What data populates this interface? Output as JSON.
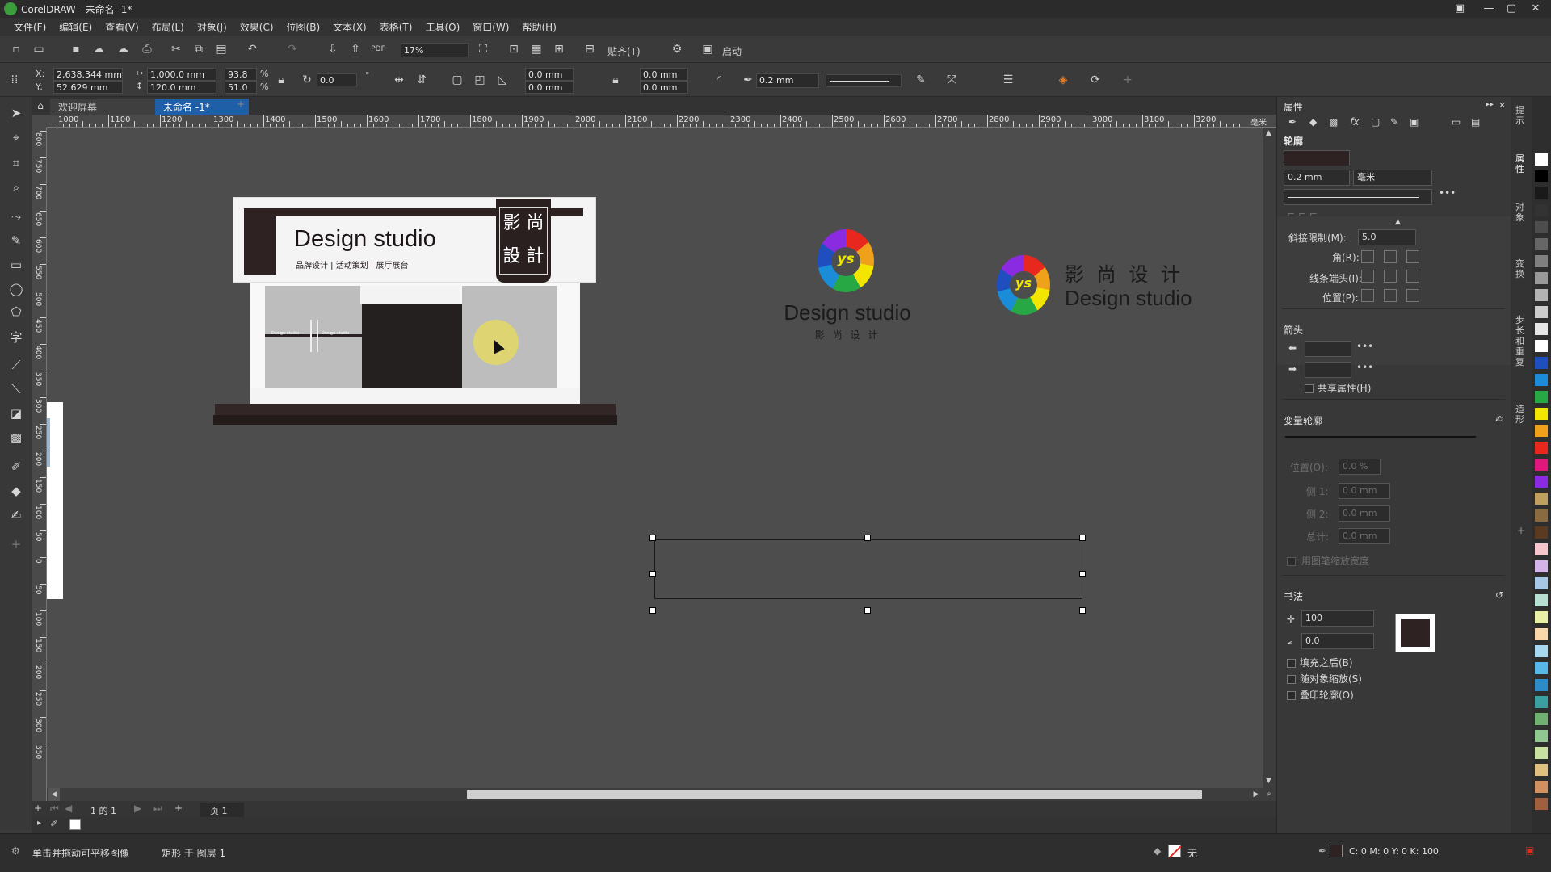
{
  "window": {
    "title": "CorelDRAW - 未命名 -1*"
  },
  "menu": [
    "文件(F)",
    "编辑(E)",
    "查看(V)",
    "布局(L)",
    "对象(J)",
    "效果(C)",
    "位图(B)",
    "文本(X)",
    "表格(T)",
    "工具(O)",
    "窗口(W)",
    "帮助(H)"
  ],
  "toolbar": {
    "zoom": "17%",
    "snap_label": "贴齐(T)",
    "launch_label": "启动"
  },
  "propbar": {
    "x_label": "X:",
    "x_value": "2,638.344 mm",
    "y_label": "Y:",
    "y_value": "52.629 mm",
    "width_value": "1,000.0 mm",
    "height_value": "120.0 mm",
    "scale_x": "93.8",
    "scale_y": "51.0",
    "pct": "%",
    "rotation": "0.0",
    "degree": "°",
    "corner_a": "0.0 mm",
    "corner_b": "0.0 mm",
    "corner_c": "0.0 mm",
    "corner_d": "0.0 mm",
    "outline_width": "0.2 mm"
  },
  "tabs": [
    {
      "label": "欢迎屏幕",
      "active": false
    },
    {
      "label": "未命名 -1*",
      "active": true
    }
  ],
  "ruler": {
    "h_labels": [
      "1000",
      "1100",
      "1200",
      "1300",
      "1400",
      "1500",
      "1600",
      "1700",
      "1800",
      "1900",
      "2000",
      "2100",
      "2200",
      "2300",
      "2400",
      "2500",
      "2600",
      "2700",
      "2800",
      "2900",
      "3000",
      "3100",
      "3200"
    ],
    "h_units": "毫米",
    "v_labels": [
      "800",
      "750",
      "700",
      "650",
      "600",
      "550",
      "500",
      "450",
      "400",
      "350",
      "300",
      "250",
      "200",
      "150",
      "100",
      "50",
      "0",
      "50",
      "100",
      "150",
      "200",
      "250",
      "300",
      "350"
    ]
  },
  "canvas": {
    "storefront": {
      "sign_title": "Design studio",
      "sign_subtitle": "品牌设计 | 活动策划 | 展厅展台",
      "seal_text": [
        "影",
        "尚",
        "設",
        "計"
      ],
      "glass_text_1": "Design studio",
      "glass_text_2": "Design studio"
    },
    "logo1": {
      "mark_text": "ys",
      "title": "Design studio",
      "subtitle": "影 尚 设 计"
    },
    "logo2": {
      "mark_text": "ys",
      "title_cn": "影  尚  设  计",
      "title_en": "Design studio"
    }
  },
  "pagebar": {
    "page_count": "1 的 1",
    "page_tab": "页 1"
  },
  "statusbar": {
    "hint": "单击并拖动可平移图像",
    "selection": "矩形 于 图层 1",
    "fill_label": "无",
    "outline_color": "C: 0 M: 0 Y: 0 K: 100"
  },
  "properties": {
    "panel_title": "属性",
    "outline_section": "轮廓",
    "outline_width": "0.2 mm",
    "outline_unit": "毫米",
    "miter_label": "斜接限制(M):",
    "miter_value": "5.0",
    "corner_label": "角(R):",
    "cap_label": "线条端头(I):",
    "position_label": "位置(P):",
    "arrows_section": "箭头",
    "share_label": "共享属性(H)",
    "variable_section": "变量轮廓",
    "var_position_label": "位置(O):",
    "var_position_value": "0.0 %",
    "var_side1_label": "侧 1:",
    "var_side1_value": "0.0 mm",
    "var_side2_label": "侧 2:",
    "var_side2_value": "0.0 mm",
    "var_total_label": "总计:",
    "var_total_value": "0.0 mm",
    "var_scale_label": "用图笔缩放宽度",
    "calligraphy_section": "书法",
    "stretch_value": "100",
    "angle_value": "0.0",
    "fill_after_label": "填充之后(B)",
    "scale_with_label": "随对象缩放(S)",
    "overprint_label": "叠印轮廓(O)"
  },
  "side_tabs": [
    "提示",
    "属性",
    "对象",
    "变换",
    "步长和重复",
    "造形"
  ],
  "palette_colors": [
    "#ffffff",
    "#000000",
    "#1a1a1a",
    "#333333",
    "#4d4d4d",
    "#666666",
    "#808080",
    "#999999",
    "#b3b3b3",
    "#cccccc",
    "#e6e6e6",
    "#ffffff",
    "#1f4fbf",
    "#1a8cd8",
    "#27a845",
    "#f2e600",
    "#f0a11b",
    "#e8281e",
    "#e0187c",
    "#8a2be2",
    "#c0a060",
    "#8a6a40",
    "#5a3a20",
    "#f5c6cb",
    "#d4b4e8",
    "#a7c7e7",
    "#b8e0d2",
    "#e8f0a8",
    "#f8d8a8",
    "#a8d8f0",
    "#58b8e8",
    "#2c8cc8",
    "#3aa0a0",
    "#70b070",
    "#90c890",
    "#c8e0a0",
    "#e0c080",
    "#d09060",
    "#a06040"
  ]
}
